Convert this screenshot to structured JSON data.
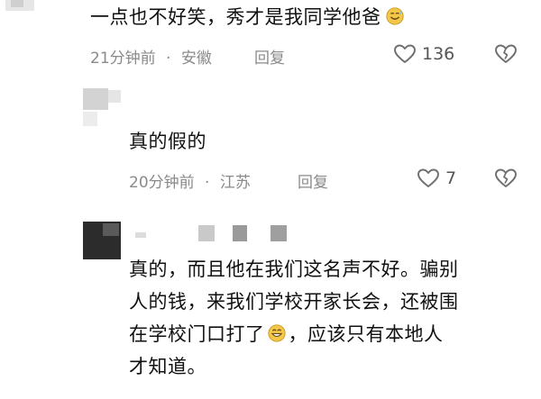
{
  "comments": [
    {
      "text_before_emoji": "一点也不好笑，秀才是我同学他爸",
      "time": "21分钟前",
      "location": "安徽",
      "reply_label": "回复",
      "like_count": "136"
    },
    {
      "text": "真的假的",
      "time": "20分钟前",
      "location": "江苏",
      "reply_label": "回复",
      "like_count": "7"
    },
    {
      "lines": [
        "真的，而且他在我们这名声不好。骗别",
        "人的钱，来我们学校开家长会，还被围",
        "在学校门口打了",
        "，应该只有本地人",
        "才知道。"
      ]
    }
  ],
  "meta_separator": "·",
  "icons": {
    "like": "heart-outline-icon",
    "dislike": "broken-heart-outline-icon",
    "emoji_1": "sweat-smile-emoji-icon",
    "emoji_2": "grin-emoji-icon"
  },
  "colors": {
    "text": "#111111",
    "meta": "#8a8a8a",
    "icon": "#6f6f6f",
    "emoji": "#f3c84a"
  }
}
